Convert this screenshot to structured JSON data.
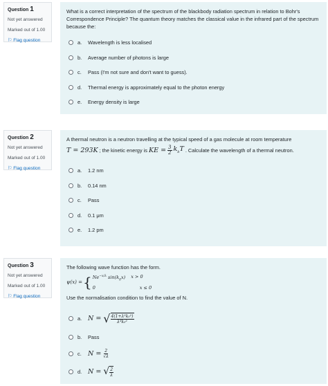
{
  "questions": [
    {
      "prefix": "Question",
      "number": "1",
      "state": "Not yet answered",
      "grade": "Marked out of 1.00",
      "flag": "Flag question",
      "text": "What is a correct interpretation of the spectrum of the blackbody radiation spectrum in relation to Bohr's Correspondence Principle? The quantum theory matches the classical value in the infrared part of the spectrum because the:",
      "answers": [
        {
          "letter": "a.",
          "text": "Wavelength is less localised"
        },
        {
          "letter": "b.",
          "text": "Average number of photons is large"
        },
        {
          "letter": "c.",
          "text": "Pass (I'm not sure and don't want to guess)."
        },
        {
          "letter": "d.",
          "text": "Thermal energy is approximately equal to the photon energy"
        },
        {
          "letter": "e.",
          "text": "Energy density is large"
        }
      ]
    },
    {
      "prefix": "Question",
      "number": "2",
      "state": "Not yet answered",
      "grade": "Marked out of 1.00",
      "flag": "Flag question",
      "text_line1": "A thermal neutron is a neutron travelling at the typical speed of a gas molecule at room temperature",
      "text_line2_math1": "T = 293K",
      "text_line2_mid": "; the kinetic energy is",
      "text_line2_math2a": "KE =",
      "frac_num": "3",
      "frac_den": "2",
      "text_line2_math2b": "k",
      "text_line2_math2sub": "b",
      "text_line2_math2c": "T",
      "text_line2_end": ". Calculate the wavelength of a thermal neutron.",
      "answers": [
        {
          "letter": "a.",
          "text": "1.2 nm"
        },
        {
          "letter": "b.",
          "text": "0.14 nm"
        },
        {
          "letter": "c.",
          "text": "Pass"
        },
        {
          "letter": "d.",
          "text": "0.1 μm"
        },
        {
          "letter": "e.",
          "text": "1.2 pm"
        }
      ]
    },
    {
      "prefix": "Question",
      "number": "3",
      "state": "Not yet answered",
      "grade": "Marked out of 1.00",
      "flag": "Flag question",
      "text1": "The following wave function has the form.",
      "wave_lhs": "ψ(x) =",
      "case1_expr": "Ne",
      "case1_exp": "−x/λ",
      "case1_sin": "sin(k",
      "case1_sub": "0",
      "case1_end": "x)",
      "case1_cond": "x > 0",
      "case2_expr": "0",
      "case2_cond": "x ≤ 0",
      "text2": "Use the normalisation condition to find the value of N.",
      "answers": [
        {
          "letter": "a.",
          "lhs": "N =",
          "num": "4(1+λ²k₀²)",
          "den": "λ³k₀²",
          "sqrt": true
        },
        {
          "letter": "b.",
          "text": "Pass"
        },
        {
          "letter": "c.",
          "lhs": "N =",
          "num": "2",
          "den": "√λ",
          "sqrt": false
        },
        {
          "letter": "d.",
          "lhs": "N =",
          "num": "2",
          "den": "λ",
          "sqrt": true
        }
      ]
    }
  ]
}
